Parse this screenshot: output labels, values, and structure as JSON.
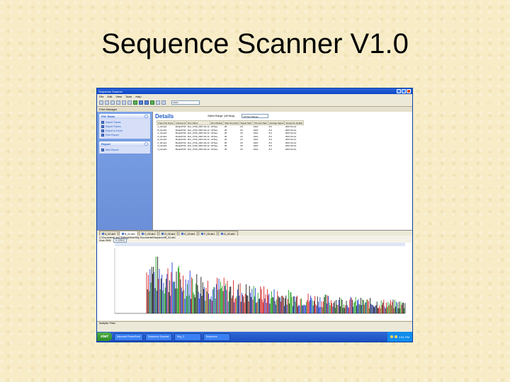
{
  "slide": {
    "title": "Sequence Scanner V1.0"
  },
  "window": {
    "title": "Sequence Scanner"
  },
  "menu": [
    "File",
    "Edit",
    "View",
    "Tools",
    "Help"
  ],
  "zoom": {
    "value": "100%"
  },
  "project": {
    "label": "Print Manager"
  },
  "side_panels": [
    {
      "title": "File Tasks",
      "items": [
        "Import Traces",
        "Export Traces",
        "Export to Excel",
        "Print Report"
      ]
    },
    {
      "title": "Report",
      "items": [
        "New Report"
      ]
    }
  ],
  "details": {
    "title": "Details",
    "seq_label": "Select Range: (All Seqs)",
    "seq_value": "(All Seq Range)",
    "columns": [
      "Trace File Name",
      "Instrument",
      "Run Name",
      "Run Module",
      "Raw Seq Start",
      "Signal Start",
      "Trimmed Start",
      "Average Signal",
      "Sequence Quality"
    ],
    "rows": [
      [
        "A_02.ab1",
        "Model3730",
        "Run_3730_2007-02-12",
        "HTSeq",
        "25",
        "20",
        "1010",
        "8.0",
        "2007-02-12"
      ],
      [
        "B_02.ab1",
        "Model3730",
        "Run_3730_2007-02-12",
        "HTSeq",
        "25",
        "20",
        "1010",
        "8.0",
        "2007-02-12"
      ],
      [
        "C_02.ab1",
        "Model3730",
        "Run_3730_2007-02-12",
        "HTSeq",
        "25",
        "20",
        "1010",
        "8.0",
        "2007-02-12"
      ],
      [
        "D_02.ab1",
        "Model3730",
        "Run_3730_2007-02-12",
        "HTSeq",
        "25",
        "20",
        "1010",
        "8.0",
        "2007-02-12"
      ],
      [
        "E_02.ab1",
        "Model3730",
        "Run_3730_2007-02-12",
        "HTSeq",
        "25",
        "20",
        "1010",
        "8.0",
        "2007-02-12"
      ],
      [
        "F_02.ab1",
        "Model3730",
        "Run_3730_2007-02-12",
        "HTSeq",
        "25",
        "20",
        "1010",
        "8.0",
        "2007-02-12"
      ],
      [
        "G_02.ab1",
        "Model3730",
        "Run_3730_2007-02-12",
        "HTSeq",
        "25",
        "20",
        "1010",
        "8.0",
        "2007-02-12"
      ],
      [
        "H_02.ab1",
        "Model3730",
        "Run_3730_2007-02-12",
        "HTSeq",
        "25",
        "20",
        "1010",
        "8.0",
        "2007-02-12"
      ]
    ]
  },
  "tabs": [
    "A_02.ab1",
    "B_02.ab1",
    "C_02.ab1",
    "D_02.ab1",
    "E_02.ab1",
    "F_02.ab1",
    "G_02.ab1"
  ],
  "trace": {
    "path": "C:\\Documents and Settings\\User\\My Documents\\Sequence\\B_02.ab1",
    "shift_label": "Scan Shift:",
    "shift_value": "0-12010"
  },
  "status": "Analysis: Pass",
  "taskbar": {
    "start": "start",
    "tasks": [
      "Microsoft PowerPoint",
      "Sequence Scanner",
      "Seq_3",
      "Sequence"
    ],
    "clock": "4:51 PM"
  },
  "colors": {
    "accent": "#215dc6",
    "trace_series": [
      "#1a1a1a",
      "#1f3fd6",
      "#d61f1f",
      "#1fa31f"
    ]
  }
}
